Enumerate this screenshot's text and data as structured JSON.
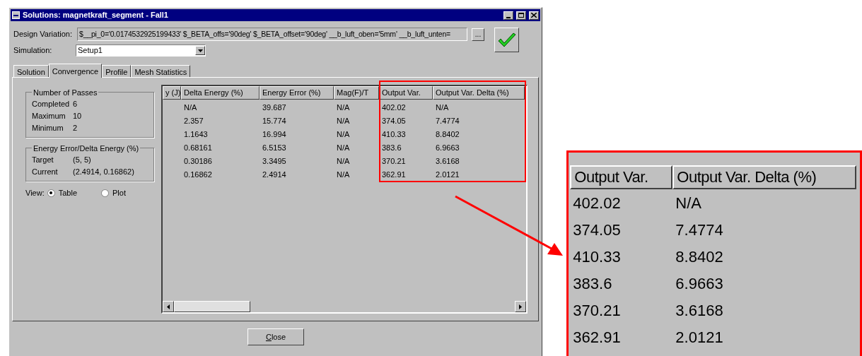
{
  "window": {
    "title": "Solutions: magnetkraft_segment - Fall1"
  },
  "design_variation": {
    "label": "Design Variation:",
    "value": "$__pi_0='0.0174532925199433' $_BETA_offs='90deg' $_BETA_offset='90deg' __b_luft_oben='5mm' __b_luft_unten=",
    "browse": "..."
  },
  "simulation": {
    "label": "Simulation:",
    "value": "Setup1"
  },
  "tabs": [
    {
      "label": "Solution",
      "selected": false
    },
    {
      "label": "Convergence",
      "selected": true
    },
    {
      "label": "Profile",
      "selected": false
    },
    {
      "label": "Mesh Statistics",
      "selected": false
    }
  ],
  "passes": {
    "title": "Number of Passes",
    "rows": [
      {
        "label": "Completed",
        "value": "6"
      },
      {
        "label": "Maximum",
        "value": "10"
      },
      {
        "label": "Minimum",
        "value": "2"
      }
    ]
  },
  "energy": {
    "title": "Energy Error/Delta Energy (%)",
    "rows": [
      {
        "label": "Target",
        "value": "(5, 5)"
      },
      {
        "label": "Current",
        "value": "(2.4914, 0.16862)"
      }
    ]
  },
  "view": {
    "label": "View:",
    "options": [
      {
        "label": "Table",
        "selected": true
      },
      {
        "label": "Plot",
        "selected": false
      }
    ]
  },
  "table": {
    "columns": [
      "y (J)",
      "Delta Energy (%)",
      "Energy Error (%)",
      "Mag(F)/T",
      "Output Var.",
      "Output Var. Delta (%)"
    ],
    "rows": [
      [
        "",
        "N/A",
        "39.687",
        "N/A",
        "402.02",
        "N/A"
      ],
      [
        "",
        "2.357",
        "15.774",
        "N/A",
        "374.05",
        "7.4774"
      ],
      [
        "",
        "1.1643",
        "16.994",
        "N/A",
        "410.33",
        "8.8402"
      ],
      [
        "",
        "0.68161",
        "6.5153",
        "N/A",
        "383.6",
        "6.9663"
      ],
      [
        "",
        "0.30186",
        "3.3495",
        "N/A",
        "370.21",
        "3.6168"
      ],
      [
        "",
        "0.16862",
        "2.4914",
        "N/A",
        "362.91",
        "2.0121"
      ]
    ]
  },
  "close_button": "Close",
  "magnified": {
    "columns": [
      "Output Var.",
      "Output Var. Delta (%)"
    ],
    "rows": [
      [
        "402.02",
        "N/A"
      ],
      [
        "374.05",
        "7.4774"
      ],
      [
        "410.33",
        "8.8402"
      ],
      [
        "383.6",
        "6.9663"
      ],
      [
        "370.21",
        "3.6168"
      ],
      [
        "362.91",
        "2.0121"
      ]
    ]
  }
}
